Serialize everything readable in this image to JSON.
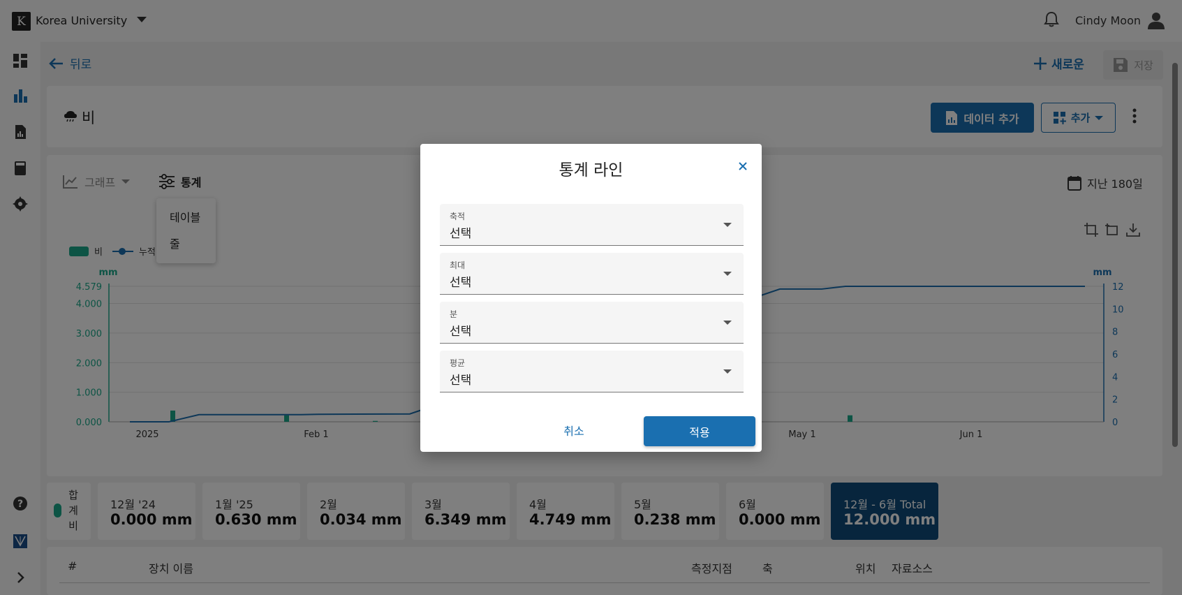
{
  "topbar": {
    "logo_letter": "K",
    "org_name": "Korea University",
    "user_name": "Cindy Moon"
  },
  "toolbar": {
    "back_label": "뒤로",
    "new_label": "새로운",
    "save_label": "저장"
  },
  "header": {
    "title": "비",
    "add_data_label": "데이터 추가",
    "add_label": "추가"
  },
  "chart_panel": {
    "graph_tab": "그래프",
    "stat_tab": "통계",
    "range_label": "지난 180일",
    "stat_menu": [
      "테이블",
      "줄"
    ],
    "legend": [
      "비",
      "누적"
    ]
  },
  "chart_data": {
    "type": "bar",
    "left_unit": "mm",
    "right_unit": "mm",
    "left_ticks": [
      "4.579",
      "4.000",
      "3.000",
      "2.000",
      "1.000",
      "0.000"
    ],
    "right_ticks": [
      "12",
      "10",
      "8",
      "6",
      "4",
      "2",
      "0"
    ],
    "x_ticks": [
      "2025",
      "Feb 1",
      "May 1",
      "Jun 1"
    ],
    "ylim_left": [
      0,
      4.579
    ],
    "ylim_right": [
      0,
      12
    ],
    "series": [
      {
        "name": "비",
        "type": "bar",
        "color": "#1aa98a"
      },
      {
        "name": "누적",
        "type": "line",
        "color": "#1a6fb0"
      }
    ]
  },
  "summary": {
    "row_label": [
      "합",
      "계",
      "비"
    ],
    "cards": [
      {
        "label": "12월 '24",
        "value": "0.000 mm"
      },
      {
        "label": "1월 '25",
        "value": "0.630 mm"
      },
      {
        "label": "2월",
        "value": "0.034 mm"
      },
      {
        "label": "3월",
        "value": "6.349 mm"
      },
      {
        "label": "4월",
        "value": "4.749 mm"
      },
      {
        "label": "5월",
        "value": "0.238 mm"
      },
      {
        "label": "6월",
        "value": "0.000 mm"
      }
    ],
    "total": {
      "label": "12월 - 6월 Total",
      "value": "12.000 mm"
    }
  },
  "table": {
    "headers": [
      "#",
      "장치 이름",
      "측정지점",
      "축",
      "위치",
      "자료소스"
    ]
  },
  "dialog": {
    "title": "통계 라인",
    "fields": [
      {
        "label": "축적",
        "value": "선택"
      },
      {
        "label": "최대",
        "value": "선택"
      },
      {
        "label": "분",
        "value": "선택"
      },
      {
        "label": "평균",
        "value": "선택"
      }
    ],
    "cancel_label": "취소",
    "apply_label": "적용"
  },
  "colors": {
    "accent": "#1a6fb0",
    "rain": "#1aa98a",
    "total_card": "#0f4a7a"
  }
}
